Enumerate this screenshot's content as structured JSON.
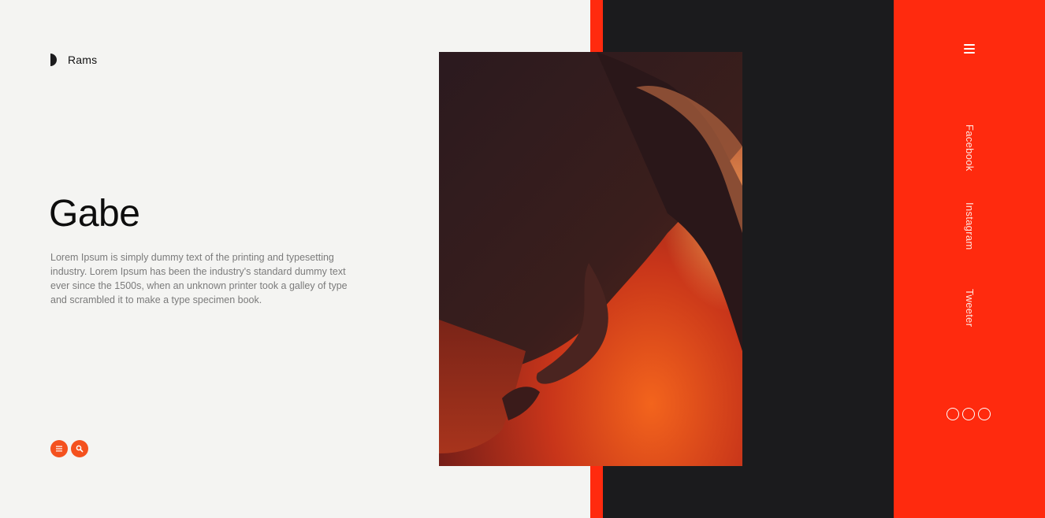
{
  "brand": {
    "name": "Rams",
    "icon": "half-circle-logo-icon"
  },
  "hero": {
    "title": "Gabe",
    "description": "Lorem Ipsum is simply dummy text of the printing and typesetting industry. Lorem Ipsum has been the industry's standard dummy text ever since the 1500s, when an unknown printer took a galley of type and scrambled it to make a type specimen book."
  },
  "actions": {
    "menu_icon": "list-icon",
    "search_icon": "search-icon"
  },
  "nav": {
    "menu_icon": "hamburger-icon",
    "social": [
      {
        "label": "Facebook"
      },
      {
        "label": "Instagram"
      },
      {
        "label": "Tweeter"
      }
    ],
    "slider_dots": 3
  },
  "colors": {
    "accent": "#ff2a0e",
    "button": "#f4511e",
    "dark": "#1b1b1d",
    "background": "#f4f4f2"
  }
}
